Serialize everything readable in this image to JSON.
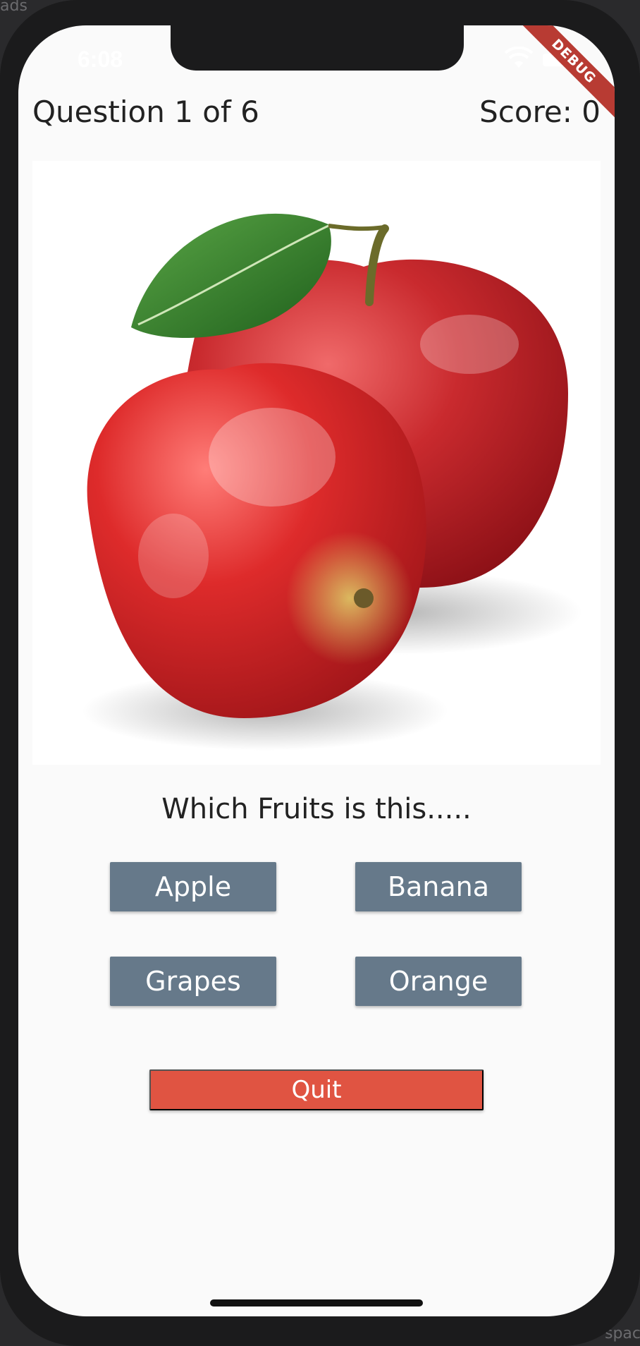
{
  "outside": {
    "top_left_text": "ads",
    "bottom_right_text": "spac"
  },
  "status_bar": {
    "time": "6:08",
    "wifi_icon": "wifi-icon",
    "battery_icon": "battery-icon"
  },
  "debug_banner": "DEBUG",
  "header": {
    "question": "Question 1 of 6",
    "score": "Score: 0"
  },
  "image": {
    "subject_icon": "apple-image"
  },
  "prompt": "Which Fruits is this.....",
  "answers": [
    "Apple",
    "Banana",
    "Grapes",
    "Orange"
  ],
  "quit_label": "Quit",
  "colors": {
    "answer_button": "#66798a",
    "quit_button": "#e05442",
    "debug_banner": "#b83b33",
    "background": "#fafafa"
  }
}
